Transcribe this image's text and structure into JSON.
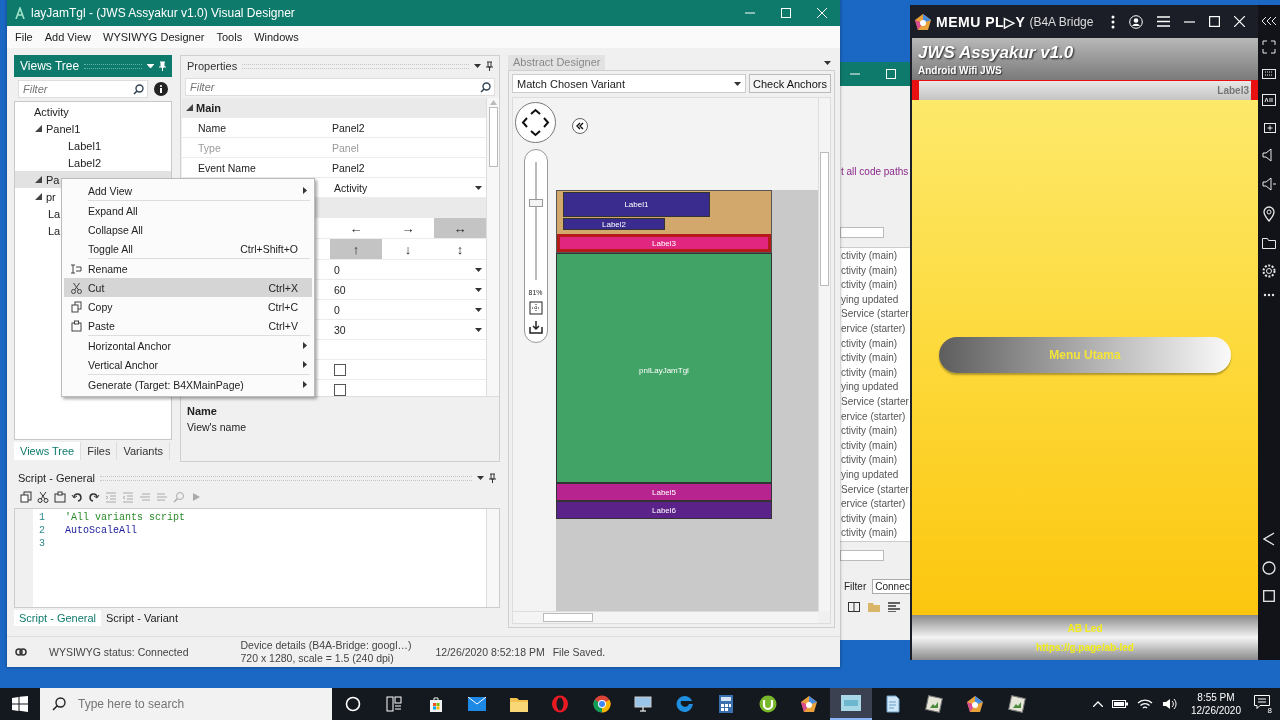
{
  "designer_window": {
    "title": "layJamTgl - (JWS Assyakur v1.0) Visual Designer",
    "menu": [
      "File",
      "Add View",
      "WYSIWYG Designer",
      "Tools",
      "Windows"
    ]
  },
  "views_tree": {
    "title": "Views Tree",
    "filter": {
      "placeholder": "Filter"
    },
    "nodes": [
      {
        "label": "Activity",
        "selected": false,
        "children": [
          {
            "label": "Panel1",
            "expanded": true,
            "selected": false,
            "children": [
              {
                "label": "Label1",
                "selected": false
              },
              {
                "label": "Label2",
                "selected": false
              }
            ]
          },
          {
            "label": "Pa",
            "expanded": true,
            "selected": true
          },
          {
            "label": "pr",
            "expanded": true,
            "selected": false
          },
          {
            "label": "La",
            "selected": false
          },
          {
            "label": "La",
            "selected": false
          }
        ]
      }
    ],
    "tabs": [
      {
        "label": "Views Tree",
        "selected": true
      },
      {
        "label": "Files",
        "selected": false
      },
      {
        "label": "Variants",
        "selected": false
      }
    ]
  },
  "properties": {
    "title": "Properties",
    "filter": {
      "placeholder": "Filter"
    },
    "section": "Main",
    "rows": [
      {
        "kind": "text",
        "name": "Name",
        "value": "Panel2",
        "disabled": false
      },
      {
        "kind": "text",
        "name": "Type",
        "value": "Panel",
        "disabled": true
      },
      {
        "kind": "text",
        "name": "Event Name",
        "value": "Panel2",
        "disabled": false
      },
      {
        "kind": "dropdown",
        "value": "Activity"
      },
      {
        "kind": "band"
      },
      {
        "kind": "anchors",
        "buttons": [
          {
            "label": "←",
            "selected": false
          },
          {
            "label": "→",
            "selected": false
          },
          {
            "label": "↔",
            "selected": true
          }
        ]
      },
      {
        "kind": "anchors",
        "buttons": [
          {
            "label": "↑",
            "selected": true
          },
          {
            "label": "↓",
            "selected": false
          },
          {
            "label": "↕",
            "selected": false
          }
        ]
      },
      {
        "kind": "dropdown",
        "value": "0"
      },
      {
        "kind": "dropdown",
        "value": "60"
      },
      {
        "kind": "dropdown",
        "value": "0"
      },
      {
        "kind": "dropdown",
        "value": "30"
      },
      {
        "kind": "blank"
      },
      {
        "kind": "checkbox",
        "checked": false
      },
      {
        "kind": "checkbox",
        "checked": false
      }
    ],
    "help": {
      "title": "Name",
      "text": "View's name"
    }
  },
  "context_menu": {
    "groups": [
      [
        {
          "kind": "submenu",
          "label": "Add View",
          "selected": false
        }
      ],
      [
        {
          "kind": "plain",
          "label": "Expand All",
          "selected": false
        },
        {
          "kind": "plain",
          "label": "Collapse All",
          "selected": false
        },
        {
          "kind": "plain",
          "label": "Toggle All",
          "shortcut": "Ctrl+Shift+O",
          "selected": false
        }
      ],
      [
        {
          "kind": "rename",
          "label": "Rename",
          "selected": false
        },
        {
          "kind": "cut",
          "label": "Cut",
          "shortcut": "Ctrl+X",
          "selected": true
        },
        {
          "kind": "copy",
          "label": "Copy",
          "shortcut": "Ctrl+C",
          "selected": false
        },
        {
          "kind": "paste",
          "label": "Paste",
          "shortcut": "Ctrl+V",
          "selected": false
        }
      ],
      [
        {
          "kind": "submenu",
          "label": "Horizontal Anchor",
          "selected": false
        },
        {
          "kind": "submenu",
          "label": "Vertical Anchor",
          "selected": false
        }
      ],
      [
        {
          "kind": "submenu",
          "label": "Generate (Target: B4XMainPage)",
          "selected": false
        }
      ]
    ]
  },
  "abstract_designer": {
    "title": "Abstract Designer",
    "variant": "Match Chosen Variant",
    "check_button": "Check Anchors",
    "zoom": {
      "level": 0.65,
      "reading": "81%"
    },
    "views": [
      {
        "kind": "panel",
        "color": "#d3a86c",
        "selected": false,
        "children": [
          {
            "label": "Label1",
            "color": "#3a2c8e",
            "selected": false
          },
          {
            "label": "Label2",
            "color": "#3a2c8e",
            "selected": false
          },
          {
            "label": "Label3",
            "color": "#e0267f",
            "selected": true
          }
        ]
      },
      {
        "kind": "label",
        "label": "pnlLayJamTgl",
        "color": "#41a366",
        "selected": false
      },
      {
        "kind": "label",
        "label": "Label5",
        "color": "#b8248f",
        "selected": false
      },
      {
        "kind": "label",
        "label": "Label6",
        "color": "#5b2389",
        "selected": false
      }
    ]
  },
  "script": {
    "title": "Script - General",
    "lines": [
      {
        "number": "1",
        "kind": "comment",
        "code": "'All variants script"
      },
      {
        "number": "2",
        "kind": "code",
        "code": "AutoScaleAll"
      },
      {
        "number": "3"
      }
    ],
    "tabs": [
      {
        "label": "Script - General",
        "selected": true
      },
      {
        "label": "Script - Variant",
        "selected": false
      }
    ]
  },
  "status_bar": {
    "wysiwyg": "WYSIWYG status: Connected",
    "device": "Device details (B4A-Bridge: googl…)",
    "device_size": "720 x 1280, scale = 1.5 (240 dpi)",
    "time": "12/26/2020 8:52:18 PM",
    "message": "File Saved."
  },
  "ide_window": {
    "warning": "t all code paths",
    "log": [
      "ctivity (main)",
      "ctivity (main)",
      "ctivity (main)",
      "ying updated",
      "Service (starter",
      "ervice (starter)",
      "ctivity (main)",
      "ctivity (main)",
      "ctivity (main)",
      "ying updated",
      "Service (starter",
      "ervice (starter)",
      "ctivity (main)",
      "ctivity (main)",
      "ctivity (main)",
      "ying updated",
      "Service (starter",
      "ervice (starter)",
      "ctivity (main)",
      "ctivity (main)"
    ],
    "filter_label": "Filter",
    "filter_value": "Connec"
  },
  "memu": {
    "logo": "MEMU PL▷Y",
    "title": "(B4A Bridge",
    "app": {
      "title": "JWS Assyakur v1.0",
      "subtitle": "Android Wifi JWS",
      "label": "Label3",
      "button": "Menu Utama",
      "footer": [
        "AB Led",
        "https://g.page/ab-led"
      ]
    }
  },
  "taskbar": {
    "search": {
      "placeholder": "Type here to search"
    },
    "apps": [
      {
        "kind": "store",
        "selected": false
      },
      {
        "kind": "mail",
        "selected": false
      },
      {
        "kind": "folder",
        "selected": false
      },
      {
        "kind": "ring",
        "selected": false
      },
      {
        "kind": "globe",
        "selected": false
      },
      {
        "kind": "monitor",
        "selected": false
      },
      {
        "kind": "edge",
        "selected": false
      },
      {
        "kind": "calculator",
        "selected": false
      },
      {
        "kind": "torrent",
        "selected": false
      },
      {
        "kind": "pentagon",
        "selected": false
      },
      {
        "kind": "b4a",
        "selected": true
      },
      {
        "kind": "notepad",
        "selected": false
      },
      {
        "kind": "viewer",
        "selected": false
      },
      {
        "kind": "pentagon",
        "selected": false
      },
      {
        "kind": "viewer",
        "selected": false
      }
    ],
    "time": "8:55 PM",
    "date": "12/26/2020",
    "notifications": "8"
  }
}
